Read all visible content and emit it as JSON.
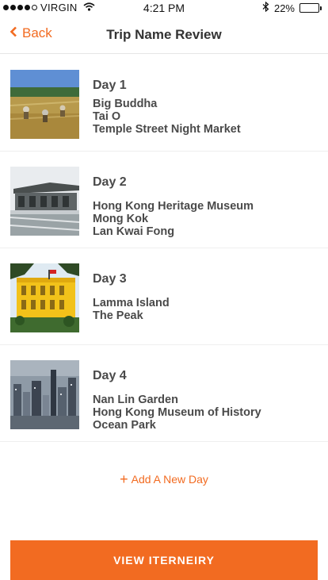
{
  "status_bar": {
    "carrier": "VIRGIN",
    "time": "4:21 PM",
    "battery": "22%",
    "battery_level": 0.22
  },
  "nav": {
    "back_label": "Back",
    "title": "Trip Name Review"
  },
  "days": [
    {
      "title": "Day 1",
      "places": [
        "Big Buddha",
        "Tai O",
        "Temple Street Night Market"
      ],
      "thumbnail": "farm-field-image"
    },
    {
      "title": "Day 2",
      "places": [
        "Hong Kong Heritage Museum",
        "Mong Kok",
        "Lan Kwai Fong"
      ],
      "thumbnail": "heritage-building-image"
    },
    {
      "title": "Day 3",
      "places": [
        "Lamma Island",
        "The Peak"
      ],
      "thumbnail": "yellow-palace-image"
    },
    {
      "title": "Day 4",
      "places": [
        "Nan Lin Garden",
        "Hong Kong Museum of History",
        "Ocean Park"
      ],
      "thumbnail": "city-skyline-image"
    }
  ],
  "actions": {
    "add_day_label": "Add A New Day",
    "view_label": "VIEW ITERNEIRY"
  },
  "colors": {
    "accent": "#f26b21",
    "text": "#4a4a4a"
  }
}
